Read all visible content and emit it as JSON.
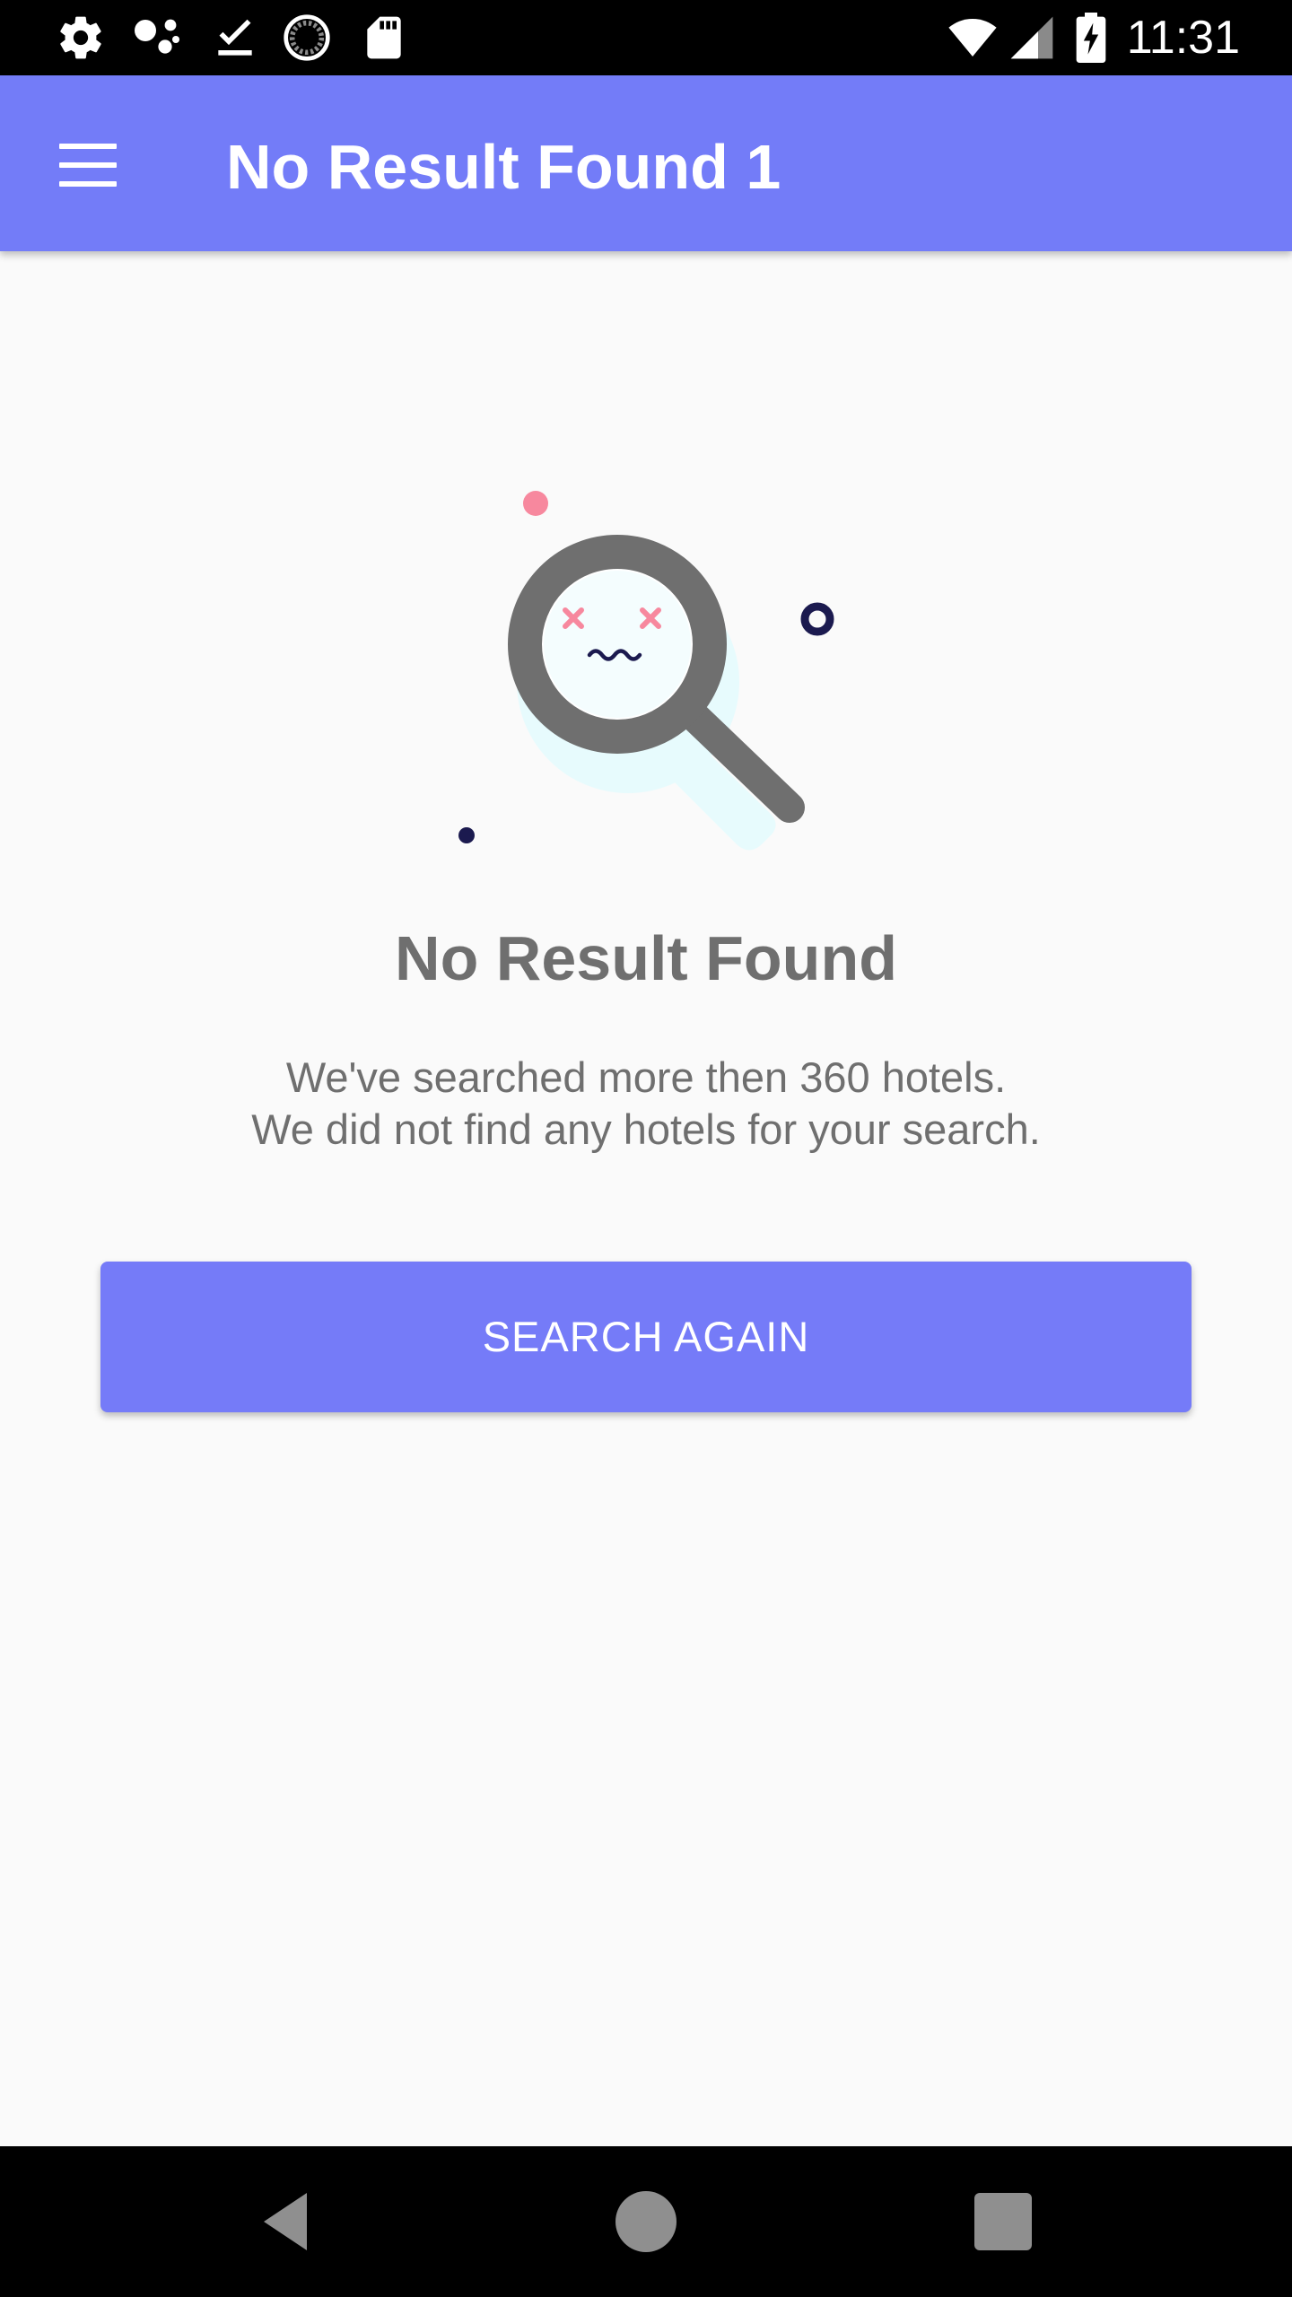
{
  "status_bar": {
    "time": "11:31",
    "icons": [
      "settings-icon",
      "assistant-dots-icon",
      "download-done-icon",
      "sync-circle-icon",
      "sd-card-icon",
      "wifi-icon",
      "signal-icon",
      "battery-charging-icon"
    ]
  },
  "app_bar": {
    "title": "No Result Found 1",
    "menu_icon": "hamburger-menu-icon"
  },
  "empty_state": {
    "illustration": "magnifier-confused-face-icon",
    "title": "No Result Found",
    "message_line1": "We've searched more then 360 hotels.",
    "message_line2": "We did not find any hotels for your search."
  },
  "actions": {
    "search_again_label": "SEARCH AGAIN"
  },
  "nav_bar": {
    "icons": [
      "back-icon",
      "home-icon",
      "recents-icon"
    ]
  },
  "colors": {
    "accent": "#737cf8",
    "text_muted": "#6f6f6f",
    "background": "#fafafa"
  }
}
